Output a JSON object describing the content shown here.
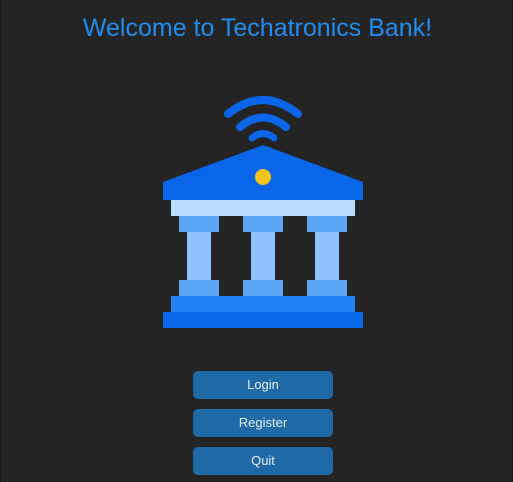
{
  "window": {
    "title": "Welcome to Techatronics Bank!"
  },
  "logo": {
    "icon": "bank-wireless-icon",
    "colors": {
      "primary_blue": "#0a66e8",
      "light_blue": "#8fc3ff",
      "mid_blue": "#5aa6f5",
      "pale_blue": "#b9dbff",
      "dot_yellow": "#f6c31c"
    }
  },
  "buttons": {
    "login": "Login",
    "register": "Register",
    "quit": "Quit"
  },
  "colors": {
    "background": "#242424",
    "title": "#1f8ef0",
    "button_bg": "#1f69a6",
    "button_text": "#e6eef6"
  }
}
